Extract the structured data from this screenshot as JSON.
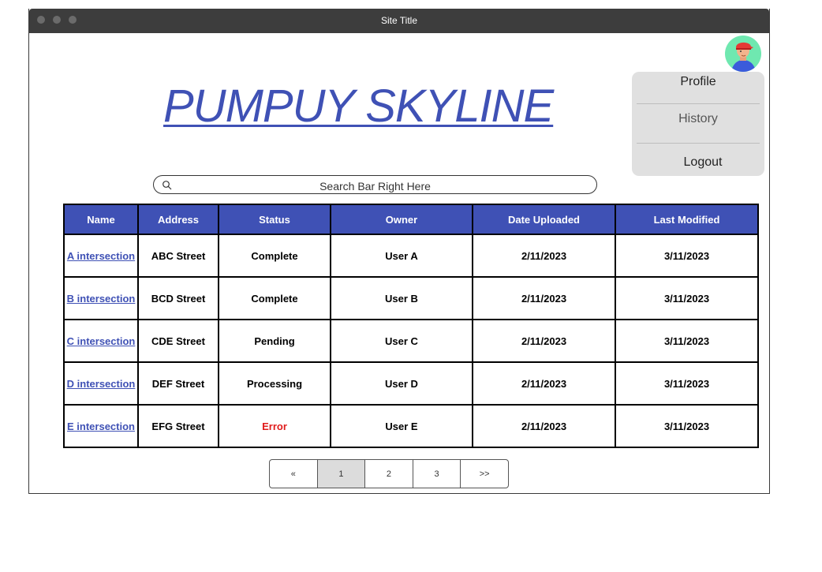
{
  "window": {
    "title": "Site Title"
  },
  "header": {
    "site_name": "PUMPUY SKYLINE"
  },
  "user_menu": {
    "items": [
      {
        "label": "Profile"
      },
      {
        "label": "History"
      },
      {
        "label": "Logout"
      }
    ]
  },
  "search": {
    "placeholder": "Search Bar Right Here"
  },
  "table": {
    "columns": [
      "Name",
      "Address",
      "Status",
      "Owner",
      "Date Uploaded",
      "Last Modified"
    ],
    "rows": [
      {
        "name": "A intersection",
        "address": "ABC Street",
        "status": "Complete",
        "owner": "User A",
        "uploaded": "2/11/2023",
        "modified": "3/11/2023"
      },
      {
        "name": "B intersection",
        "address": "BCD Street",
        "status": "Complete",
        "owner": "User B",
        "uploaded": "2/11/2023",
        "modified": "3/11/2023"
      },
      {
        "name": "C intersection",
        "address": "CDE Street",
        "status": "Pending",
        "owner": "User C",
        "uploaded": "2/11/2023",
        "modified": "3/11/2023"
      },
      {
        "name": "D intersection",
        "address": "DEF Street",
        "status": "Processing",
        "owner": "User D",
        "uploaded": "2/11/2023",
        "modified": "3/11/2023"
      },
      {
        "name": "E intersection",
        "address": "EFG Street",
        "status": "Error",
        "owner": "User E",
        "uploaded": "2/11/2023",
        "modified": "3/11/2023"
      }
    ]
  },
  "pagination": {
    "prev": "«",
    "pages": [
      "1",
      "2",
      "3"
    ],
    "next": ">>",
    "current": "1"
  },
  "colors": {
    "accent": "#3f51b5",
    "error": "#e01b1b",
    "titlebar": "#3d3d3d",
    "menu_bg": "#e0e0e0"
  }
}
